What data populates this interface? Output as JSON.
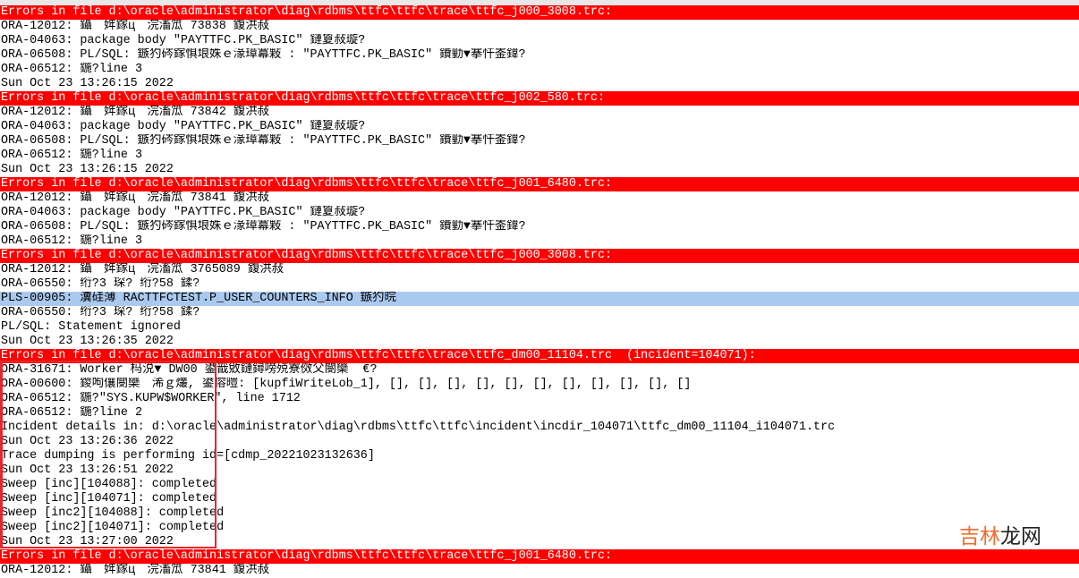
{
  "log": {
    "lines": [
      {
        "kind": "header",
        "text": "Errors in file d:\\oracle\\administrator\\diag\\rdbms\\ttfc\\ttfc\\trace\\ttfc_j000_3008.trc:"
      },
      {
        "kind": "normal",
        "text": "ORA-12012: 鑷　姩鎵ц　浣滀笟 73838 鍑洪敊"
      },
      {
        "kind": "normal",
        "text": "ORA-04063: package body \"PAYTTFC.PK_BASIC\" 鏈夐敊璇?"
      },
      {
        "kind": "normal",
        "text": "ORA-06508: PL/SQL: 鏃犳硶鎵惧埌姝ｅ湪璋冪敤 : \"PAYTTFC.PK_BASIC\" 鐨勭▼搴忓崟鍏?"
      },
      {
        "kind": "normal",
        "text": "ORA-06512: 鍦?line 3"
      },
      {
        "kind": "normal",
        "text": "Sun Oct 23 13:26:15 2022"
      },
      {
        "kind": "header",
        "text": "Errors in file d:\\oracle\\administrator\\diag\\rdbms\\ttfc\\ttfc\\trace\\ttfc_j002_580.trc:"
      },
      {
        "kind": "normal",
        "text": "ORA-12012: 鑷　姩鎵ц　浣滀笟 73842 鍑洪敊"
      },
      {
        "kind": "normal",
        "text": "ORA-04063: package body \"PAYTTFC.PK_BASIC\" 鏈夐敊璇?"
      },
      {
        "kind": "normal",
        "text": "ORA-06508: PL/SQL: 鏃犳硶鎵惧埌姝ｅ湪璋冪敤 : \"PAYTTFC.PK_BASIC\" 鐨勭▼搴忓崟鍏?"
      },
      {
        "kind": "normal",
        "text": "ORA-06512: 鍦?line 3"
      },
      {
        "kind": "normal",
        "text": "Sun Oct 23 13:26:15 2022"
      },
      {
        "kind": "header",
        "text": "Errors in file d:\\oracle\\administrator\\diag\\rdbms\\ttfc\\ttfc\\trace\\ttfc_j001_6480.trc:"
      },
      {
        "kind": "normal",
        "text": "ORA-12012: 鑷　姩鎵ц　浣滀笟 73841 鍑洪敊"
      },
      {
        "kind": "normal",
        "text": "ORA-04063: package body \"PAYTTFC.PK_BASIC\" 鏈夐敊璇?"
      },
      {
        "kind": "normal",
        "text": "ORA-06508: PL/SQL: 鏃犳硶鎵惧埌姝ｅ湪璋冪敤 : \"PAYTTFC.PK_BASIC\" 鐨勭▼搴忓崟鍏?"
      },
      {
        "kind": "normal",
        "text": "ORA-06512: 鍦?line 3"
      },
      {
        "kind": "header",
        "text": "Errors in file d:\\oracle\\administrator\\diag\\rdbms\\ttfc\\ttfc\\trace\\ttfc_j000_3008.trc:"
      },
      {
        "kind": "normal",
        "text": "ORA-12012: 鑷　姩鎵ц　浣滀笟 3765089 鍑洪敊"
      },
      {
        "kind": "normal",
        "text": "ORA-06550: 绗?3 琛? 绗?58 鍒?"
      },
      {
        "kind": "highlight",
        "text": "PLS-00905: 瀵硅薄 RACTTFCTEST.P_USER_COUNTERS_INFO 鏃犳晥"
      },
      {
        "kind": "normal",
        "text": "ORA-06550: 绗?3 琛? 绗?58 鍒?"
      },
      {
        "kind": "normal",
        "text": "PL/SQL: Statement ignored"
      },
      {
        "kind": "normal",
        "text": "Sun Oct 23 13:26:35 2022"
      },
      {
        "kind": "header",
        "text": "Errors in file d:\\oracle\\administrator\\diag\\rdbms\\ttfc\\ttfc\\trace\\ttfc_dm00_11104.trc  (incident=104071):"
      },
      {
        "kind": "normal",
        "text": "ORA-31671: Worker 杩涚▼ DW00 鍙戠敓鏈鐞嗙殑寮傚父閿欒  €?"
      },
      {
        "kind": "normal",
        "text": "ORA-00600: 鍐呴儴閿欒　浠ｇ爜, 鍙傛暟: [kupfiWriteLob_1], [], [], [], [], [], [], [], [], [], [], []"
      },
      {
        "kind": "normal",
        "text": "ORA-06512: 鍦?\"SYS.KUPW$WORKER\", line 1712"
      },
      {
        "kind": "normal",
        "text": "ORA-06512: 鍦?line 2"
      },
      {
        "kind": "normal",
        "text": "Incident details in: d:\\oracle\\administrator\\diag\\rdbms\\ttfc\\ttfc\\incident\\incdir_104071\\ttfc_dm00_11104_i104071.trc"
      },
      {
        "kind": "normal",
        "text": "Sun Oct 23 13:26:36 2022"
      },
      {
        "kind": "normal",
        "text": "Trace dumping is performing id=[cdmp_20221023132636]"
      },
      {
        "kind": "normal",
        "text": "Sun Oct 23 13:26:51 2022"
      },
      {
        "kind": "normal",
        "text": "Sweep [inc][104088]: completed"
      },
      {
        "kind": "normal",
        "text": "Sweep [inc][104071]: completed"
      },
      {
        "kind": "normal",
        "text": "Sweep [inc2][104088]: completed"
      },
      {
        "kind": "normal",
        "text": "Sweep [inc2][104071]: completed"
      },
      {
        "kind": "normal",
        "text": "Sun Oct 23 13:27:00 2022"
      },
      {
        "kind": "header",
        "text": "Errors in file d:\\oracle\\administrator\\diag\\rdbms\\ttfc\\ttfc\\trace\\ttfc_j001_6480.trc:"
      },
      {
        "kind": "normal",
        "text": "ORA-12012: 鑷　姩鎵ц　浣滀笟 73841 鍑洪敊"
      }
    ]
  },
  "watermark": {
    "part1": "吉林",
    "part2": "龙网"
  },
  "colors": {
    "header_bg": "#ff0000",
    "highlight_bg": "#aac9ee",
    "selection_box": "#e8262b"
  }
}
